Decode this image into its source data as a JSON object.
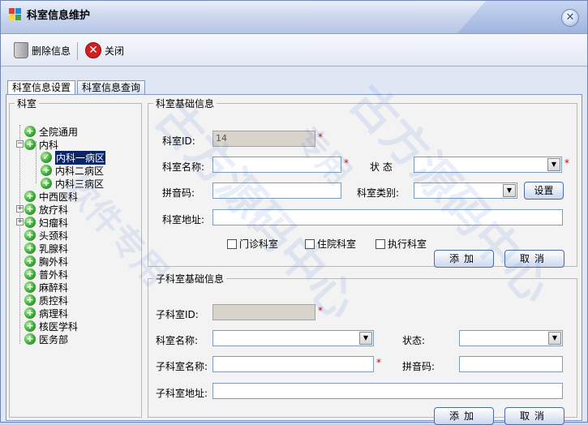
{
  "window": {
    "title": "科室信息维护",
    "close_symbol": "✕"
  },
  "toolbar": {
    "delete_label": "删除信息",
    "close_label": "关闭",
    "close_symbol": "✕"
  },
  "tabs": [
    {
      "label": "科室信息设置",
      "active": true
    },
    {
      "label": "科室信息查询",
      "active": false
    }
  ],
  "tree": {
    "legend": "科室",
    "nodes": [
      {
        "label": "全院通用",
        "level": 0,
        "expander": ""
      },
      {
        "label": "内科",
        "level": 0,
        "expander": "−"
      },
      {
        "label": "内科一病区",
        "level": 1,
        "expander": "",
        "selected": true
      },
      {
        "label": "内科二病区",
        "level": 1,
        "expander": ""
      },
      {
        "label": "内科三病区",
        "level": 1,
        "expander": ""
      },
      {
        "label": "中西医科",
        "level": 0,
        "expander": ""
      },
      {
        "label": "放疗科",
        "level": 0,
        "expander": "+"
      },
      {
        "label": "妇瘤科",
        "level": 0,
        "expander": "+"
      },
      {
        "label": "头颈科",
        "level": 0,
        "expander": ""
      },
      {
        "label": "乳腺科",
        "level": 0,
        "expander": ""
      },
      {
        "label": "胸外科",
        "level": 0,
        "expander": ""
      },
      {
        "label": "普外科",
        "level": 0,
        "expander": ""
      },
      {
        "label": "麻醉科",
        "level": 0,
        "expander": ""
      },
      {
        "label": "质控科",
        "level": 0,
        "expander": ""
      },
      {
        "label": "病理科",
        "level": 0,
        "expander": ""
      },
      {
        "label": "核医学科",
        "level": 0,
        "expander": ""
      },
      {
        "label": "医务部",
        "level": 0,
        "expander": ""
      }
    ]
  },
  "dept_form": {
    "legend": "科室基础信息",
    "id_label": "科室ID:",
    "id_value": "14",
    "name_label": "科室名称:",
    "name_value": "",
    "status_label": "状 态",
    "status_value": "",
    "pinyin_label": "拼音码:",
    "pinyin_value": "",
    "type_label": "科室类别:",
    "type_value": "",
    "settings_label": "设置",
    "address_label": "科室地址:",
    "address_value": "",
    "checkboxes": [
      "门诊科室",
      "住院科室",
      "执行科室"
    ],
    "add_label": "添加",
    "cancel_label": "取消",
    "required_mark": "*"
  },
  "sub_form": {
    "legend": "子科室基础信息",
    "id_label": "子科室ID:",
    "id_value": "",
    "dept_label": "科室名称:",
    "dept_value": "",
    "status_label": "状态:",
    "status_value": "",
    "name_label": "子科室名称:",
    "name_value": "",
    "pinyin_label": "拼音码:",
    "pinyin_value": "",
    "address_label": "子科室地址:",
    "address_value": "",
    "add_label": "添加",
    "cancel_label": "取消",
    "required_mark": "*"
  },
  "watermarks": [
    "软件专用",
    "古方源码中心",
    "专用",
    "古方源码中心"
  ],
  "colors": {
    "accent": "#4a6aa5",
    "required": "#d00000",
    "selection": "#0a246a"
  }
}
